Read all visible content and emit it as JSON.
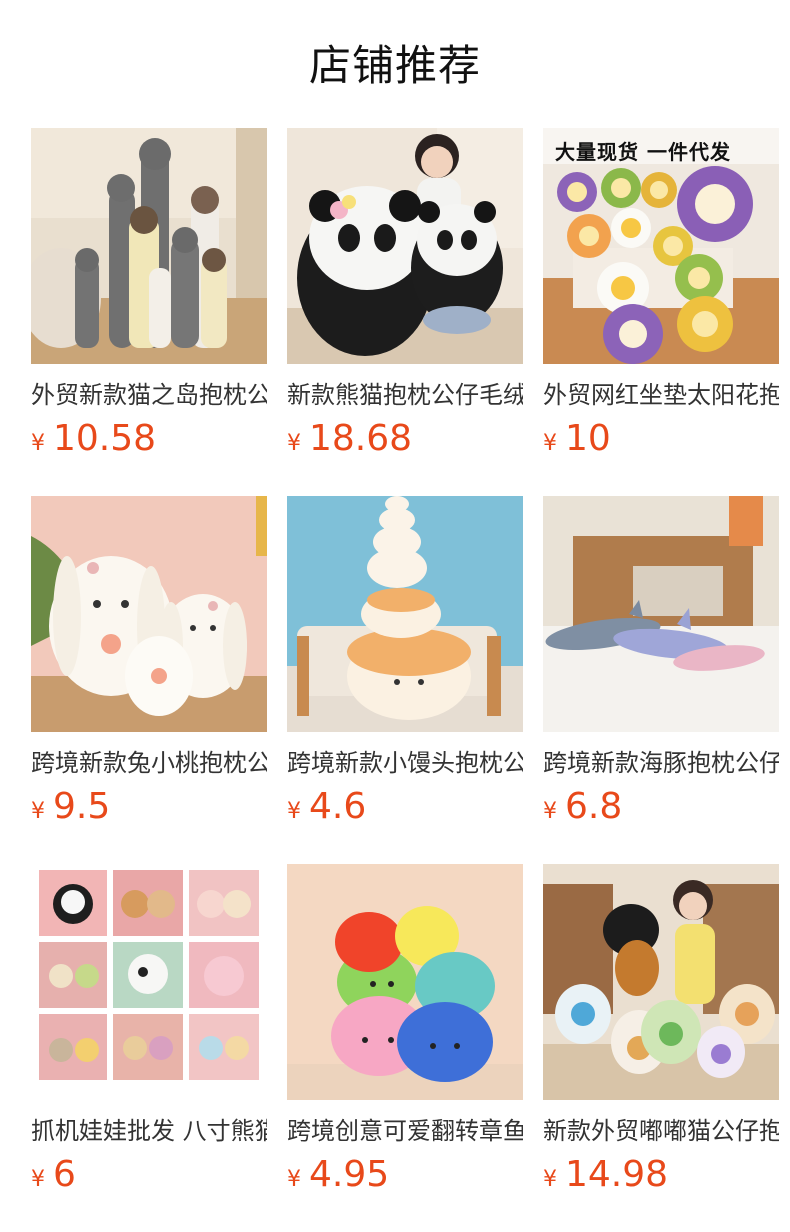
{
  "header": {
    "title": "店铺推荐"
  },
  "products": [
    {
      "name": "外贸新款猫之岛抱枕公仔",
      "currency": "¥",
      "price": "10.58",
      "thumb_icon": "long-cat-plush-image"
    },
    {
      "name": "新款熊猫抱枕公仔毛绒玩具",
      "currency": "¥",
      "price": "18.68",
      "thumb_icon": "panda-plush-image"
    },
    {
      "name": "外贸网红坐垫太阳花抱枕",
      "currency": "¥",
      "price": "10",
      "thumb_icon": "sunflower-cushion-image",
      "overlay": "大量现货  一件代发"
    },
    {
      "name": "跨境新款兔小桃抱枕公仔",
      "currency": "¥",
      "price": "9.5",
      "thumb_icon": "bunny-plush-image"
    },
    {
      "name": "跨境新款小馒头抱枕公仔",
      "currency": "¥",
      "price": "4.6",
      "thumb_icon": "bun-stack-plush-image"
    },
    {
      "name": "跨境新款海豚抱枕公仔",
      "currency": "¥",
      "price": "6.8",
      "thumb_icon": "dolphin-plush-image"
    },
    {
      "name": "抓机娃娃批发 八寸熊猫公仔",
      "currency": "¥",
      "price": "6",
      "thumb_icon": "claw-machine-dolls-image"
    },
    {
      "name": "跨境创意可爱翻转章鱼公仔",
      "currency": "¥",
      "price": "4.95",
      "thumb_icon": "octopus-plush-image"
    },
    {
      "name": "新款外贸嘟嘟猫公仔抱枕",
      "currency": "¥",
      "price": "14.98",
      "thumb_icon": "dudu-cat-plush-image"
    }
  ],
  "colors": {
    "price": "#e8491a",
    "text": "#333333",
    "title": "#111111"
  }
}
